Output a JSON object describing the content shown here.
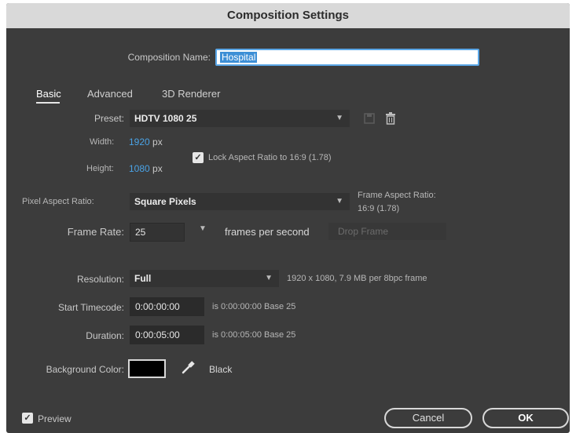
{
  "window": {
    "title": "Composition Settings"
  },
  "comp_name": {
    "label": "Composition Name:",
    "value": "Hospital"
  },
  "tabs": [
    {
      "label": "Basic",
      "active": true
    },
    {
      "label": "Advanced",
      "active": false
    },
    {
      "label": "3D Renderer",
      "active": false
    }
  ],
  "preset": {
    "label": "Preset:",
    "value": "HDTV 1080 25"
  },
  "width": {
    "label": "Width:",
    "value": "1920",
    "unit": "px"
  },
  "height": {
    "label": "Height:",
    "value": "1080",
    "unit": "px"
  },
  "lock_aspect": {
    "label": "Lock Aspect Ratio to 16:9 (1.78)",
    "checked": true
  },
  "pixel_aspect": {
    "label": "Pixel Aspect Ratio:",
    "value": "Square Pixels"
  },
  "frame_aspect": {
    "label": "Frame Aspect Ratio:",
    "value": "16:9 (1.78)"
  },
  "frame_rate": {
    "label": "Frame Rate:",
    "value": "25",
    "unit": "frames per second",
    "drop_frame": "Drop Frame"
  },
  "resolution": {
    "label": "Resolution:",
    "value": "Full",
    "info": "1920 x 1080, 7.9 MB per 8bpc frame"
  },
  "start_timecode": {
    "label": "Start Timecode:",
    "value": "0:00:00:00",
    "info": "is 0:00:00:00  Base 25"
  },
  "duration": {
    "label": "Duration:",
    "value": "0:00:05:00",
    "info": "is 0:00:05:00  Base 25"
  },
  "background": {
    "label": "Background Color:",
    "color_name": "Black",
    "color": "#000000"
  },
  "footer": {
    "preview_label": "Preview",
    "preview_checked": true,
    "cancel_label": "Cancel",
    "ok_label": "OK"
  },
  "icons": {
    "chevron": "chevron-down-icon",
    "eyedropper": "eyedropper-icon",
    "trash": "trash-icon",
    "save_preset": "save-preset-icon",
    "check": "check-icon"
  },
  "colors": {
    "dialog_bg": "#3c3c3c",
    "titlebar_bg": "#d9d9d9",
    "accent_blue": "#4aa3e6",
    "field_bg": "#2b2b2b"
  }
}
